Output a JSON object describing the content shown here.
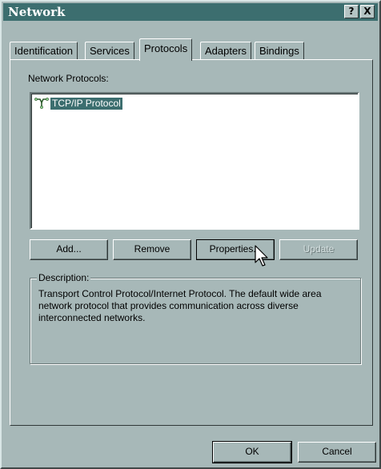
{
  "window": {
    "title": "Network",
    "help_label": "?",
    "close_label": "X"
  },
  "tabs": [
    {
      "label": "Identification",
      "active": false
    },
    {
      "label": "Services",
      "active": false
    },
    {
      "label": "Protocols",
      "active": true
    },
    {
      "label": "Adapters",
      "active": false
    },
    {
      "label": "Bindings",
      "active": false
    }
  ],
  "protocols": {
    "list_label": "Network Protocols:",
    "items": [
      {
        "label": "TCP/IP Protocol",
        "selected": true,
        "icon": "network-protocol-icon"
      }
    ]
  },
  "buttons": {
    "add": "Add...",
    "remove": "Remove",
    "properties": "Properties...",
    "update": "Update"
  },
  "description": {
    "legend": "Description:",
    "text": "Transport Control Protocol/Internet Protocol. The default wide area network protocol that provides communication across diverse interconnected networks."
  },
  "dialog_buttons": {
    "ok": "OK",
    "cancel": "Cancel"
  },
  "colors": {
    "face": "#a7b8b8",
    "titlebar": "#3c6e6f",
    "selection": "#3c6e6f"
  }
}
